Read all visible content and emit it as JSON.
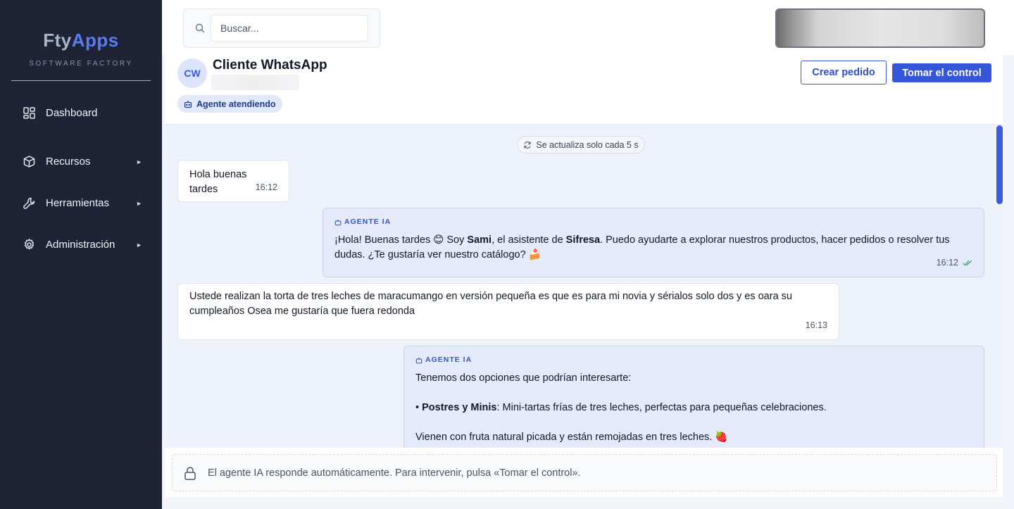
{
  "sidebar": {
    "brand_fty": "Fty",
    "brand_apps": "Apps",
    "brand_sub": "SOFTWARE FACTORY",
    "items": [
      {
        "label": "Dashboard",
        "icon": "dashboard-icon",
        "has_submenu": false
      },
      {
        "label": "Recursos",
        "icon": "box-icon",
        "has_submenu": true
      },
      {
        "label": "Herramientas",
        "icon": "wrench-icon",
        "has_submenu": true
      },
      {
        "label": "Administración",
        "icon": "gear-icon",
        "has_submenu": true
      }
    ],
    "arrow": "►"
  },
  "search": {
    "placeholder": "Buscar..."
  },
  "chat": {
    "avatar_initials": "CW",
    "contact_name": "Cliente WhatsApp",
    "status": "Agente atendiendo",
    "create_order_label": "Crear pedido",
    "take_control_label": "Tomar el control",
    "refresh_note": "Se actualiza solo cada 5 s",
    "agent_tag": "AGENTE IA",
    "messages": [
      {
        "direction": "in",
        "text": "Hola buenas tardes",
        "time": "16:12"
      },
      {
        "direction": "out",
        "p1": "¡Hola! Buenas tardes 😊 Soy ",
        "bold1": "Sami",
        "p2": ", el asistente de ",
        "bold2": "Sifresa",
        "p3": ". Puedo ayudarte a explorar nuestros productos, hacer pedidos o resolver tus dudas. ¿Te gustaría ver nuestro catálogo? 🍰",
        "time": "16:12"
      },
      {
        "direction": "in",
        "text": "Ustede realizan la torta de tres leches de maracumango en versión pequeña es que es para mi novia y sérialos solo dos y es oara su cumpleaños Osea me gustaría que fuera redonda",
        "time": "16:13"
      },
      {
        "direction": "out",
        "line1": "Tenemos dos opciones que podrían interesarte:",
        "bullet": "• ",
        "bold": "Postres y Minis",
        "line2": ": Mini-tartas frías de tres leches, perfectas para pequeñas celebraciones.",
        "line3": "Vienen con fruta natural picada y están remojadas en tres leches. 🍓"
      }
    ]
  },
  "composer": {
    "text": "El agente IA responde automáticamente. Para intervenir, pulsa «Tomar el control»."
  },
  "colors": {
    "sidebar_bg": "#1e2436",
    "accent": "#3655d8",
    "brand_apps": "#5b7cf0",
    "agent_bubble": "#e5eafb"
  }
}
